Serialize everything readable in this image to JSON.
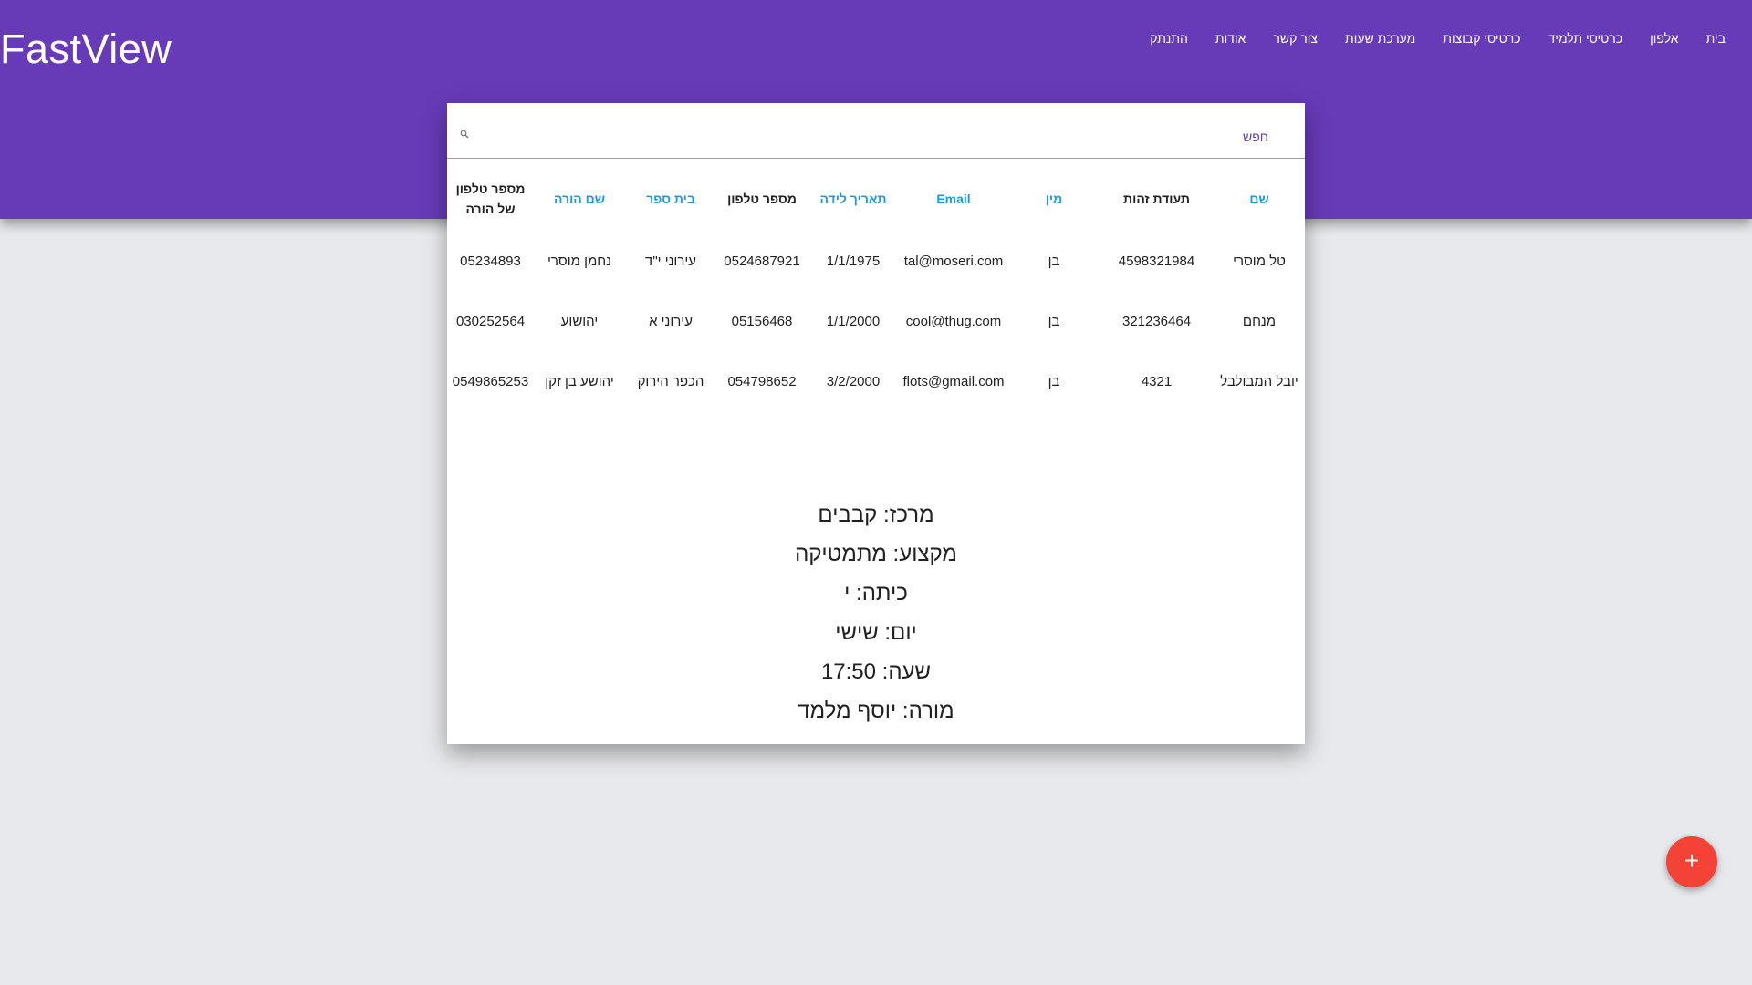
{
  "header": {
    "brand": "FastView",
    "nav": [
      "בית",
      "אלפון",
      "כרטיסי תלמיד",
      "כרטיסי קבוצות",
      "מערכת שעות",
      "צור קשר",
      "אודות",
      "התנתק"
    ],
    "background_color": "#673ab7"
  },
  "search": {
    "label": "חפש",
    "placeholder": "",
    "icon": "search-icon"
  },
  "table": {
    "columns": [
      {
        "label": "שם",
        "sortable": true
      },
      {
        "label": "תעודת זהות",
        "sortable": false
      },
      {
        "label": "מין",
        "sortable": true
      },
      {
        "label": "Email",
        "sortable": true
      },
      {
        "label": "תאריך לידה",
        "sortable": true
      },
      {
        "label": "מספר טלפון",
        "sortable": false
      },
      {
        "label": "בית ספר",
        "sortable": true
      },
      {
        "label": "שם הורה",
        "sortable": true
      },
      {
        "label": "מספר טלפון של הורה",
        "sortable": false
      }
    ],
    "rows": [
      [
        "טל מוסרי",
        "4598321984",
        "בן",
        "tal@moseri.com",
        "1/1/1975",
        "0524687921",
        "עירוני י\"ד",
        "נחמן מוסרי",
        "05234893"
      ],
      [
        "מנחם",
        "321236464",
        "בן",
        "cool@thug.com",
        "1/1/2000",
        "05156468",
        "עירוני א",
        "יהושוע",
        "030252564"
      ],
      [
        "יובל המבולבל",
        "4321",
        "בן",
        "flots@gmail.com",
        "3/2/2000",
        "054798652",
        "הכפר הירוק",
        "יהושע בן זקן",
        "0549865253"
      ]
    ]
  },
  "info": {
    "center": "מרכז: קבבים",
    "subject": "מקצוע: מתמטיקה",
    "class": "כיתה: י",
    "day": "יום: שישי",
    "time": "שעה: 17:50",
    "teacher": "מורה: יוסף מלמד"
  },
  "fab": {
    "label": "+",
    "color": "#f44336"
  },
  "colors": {
    "sortable_header": "#1e9bd7",
    "page_background": "#e8e9ec"
  }
}
